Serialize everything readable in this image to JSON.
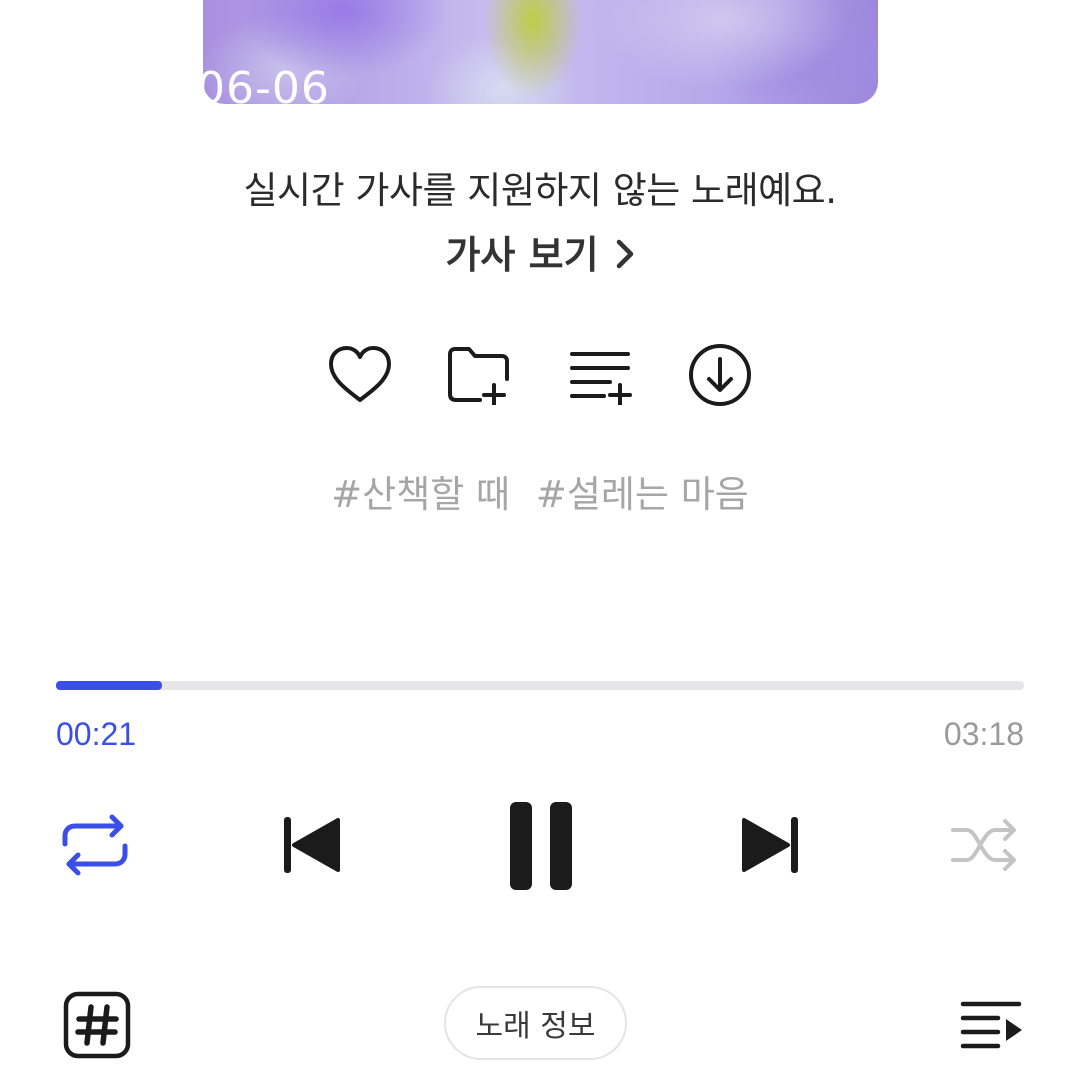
{
  "album": {
    "date_overlay": "06-06"
  },
  "lyrics": {
    "message": "실시간 가사를 지원하지 않는 노래예요.",
    "view_label": "가사 보기"
  },
  "actions": {
    "like_icon": "heart-icon",
    "add_to_folder_icon": "folder-plus-icon",
    "add_to_playlist_icon": "playlist-plus-icon",
    "download_icon": "download-icon"
  },
  "tags": [
    "#산책할 때",
    "#설레는 마음"
  ],
  "player": {
    "progress_fraction": 0.11,
    "current_time": "00:21",
    "duration": "03:18",
    "repeat_active": true,
    "shuffle_active": false,
    "state": "playing"
  },
  "bottom_bar": {
    "hashtag_icon": "hashtag-icon",
    "song_info_label": "노래 정보",
    "queue_icon": "queue-icon"
  },
  "colors": {
    "accent": "#3b4ee8",
    "muted": "#a6a6a6",
    "progress_track": "#e6e6e8"
  }
}
